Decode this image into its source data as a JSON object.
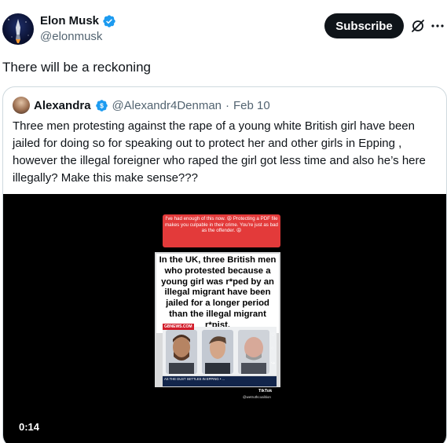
{
  "author": {
    "name": "Elon Musk",
    "handle": "@elonmusk",
    "verified_color": "#1d9bf0"
  },
  "actions": {
    "subscribe_label": "Subscribe",
    "grok_icon": "grok-icon",
    "more_icon": "more-icon"
  },
  "tweet": {
    "text": "There will be a reckoning"
  },
  "quote": {
    "name": "Alexandra",
    "handle": "@Alexandr4Denman",
    "dot": "·",
    "date": "Feb 10",
    "text": "Three men protesting against the rape of a young white British girl have been jailed for doing so for speaking out to protect her and other girls in Epping , however the illegal foreigner who raped the girl got less time and also he’s here illegally? Make this make sense???"
  },
  "video": {
    "timestamp": "0:14",
    "overlay_caption": "I've had enough of this now. 😡 Protecting a PDF file makes you culpable in their crime. You're just as bad as the offender. 😡",
    "headline": "In the UK, three British men who protested because a young girl was r*ped by an illegal migrant have been jailed for a longer period than the illegal migrant r*pist.",
    "news_tag": "GBNEWS.COM",
    "ticker": "AS THE DUST SETTLES IN EPPING • ...",
    "tiktok_label": "TikTok",
    "tiktok_user": "@wetruthcoalition"
  }
}
